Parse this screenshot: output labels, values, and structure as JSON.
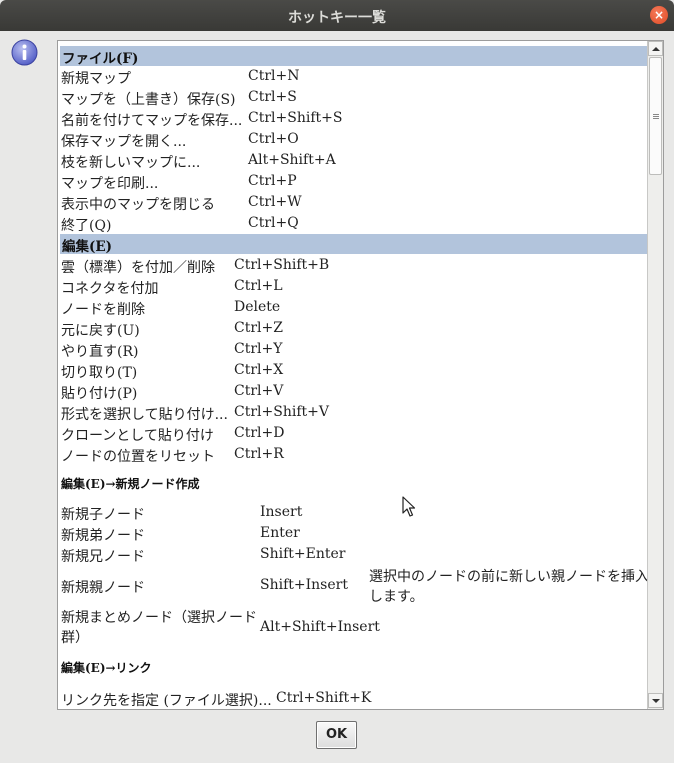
{
  "window": {
    "title": "ホットキー一覧",
    "close_label": "×"
  },
  "sections": [
    {
      "title": "ファイル(F)",
      "rows": [
        [
          "新規マップ",
          "Ctrl+N"
        ],
        [
          "マップを（上書き）保存(S)",
          "Ctrl+S"
        ],
        [
          "名前を付けてマップを保存...",
          "Ctrl+Shift+S"
        ],
        [
          "保存マップを開く...",
          "Ctrl+O"
        ],
        [
          "枝を新しいマップに...",
          "Alt+Shift+A"
        ],
        [
          "マップを印刷...",
          "Ctrl+P"
        ],
        [
          "表示中のマップを閉じる",
          "Ctrl+W"
        ],
        [
          "終了(Q)",
          "Ctrl+Q"
        ]
      ]
    },
    {
      "title": "編集(E)",
      "rows": [
        [
          "雲（標準）を付加／削除",
          "Ctrl+Shift+B"
        ],
        [
          "コネクタを付加",
          "Ctrl+L"
        ],
        [
          "ノードを削除",
          "Delete"
        ],
        [
          "元に戻す(U)",
          "Ctrl+Z"
        ],
        [
          "やり直す(R)",
          "Ctrl+Y"
        ],
        [
          "切り取り(T)",
          "Ctrl+X"
        ],
        [
          "貼り付け(P)",
          "Ctrl+V"
        ],
        [
          "形式を選択して貼り付け...",
          "Ctrl+Shift+V"
        ],
        [
          "クローンとして貼り付け",
          "Ctrl+D"
        ],
        [
          "ノードの位置をリセット",
          "Ctrl+R"
        ]
      ]
    }
  ],
  "subsections": [
    {
      "title": "編集(E)→新規ノード作成",
      "rows": [
        [
          "新規子ノード",
          "Insert",
          ""
        ],
        [
          "新規弟ノード",
          "Enter",
          ""
        ],
        [
          "新規兄ノード",
          "Shift+Enter",
          ""
        ],
        [
          "新規親ノード",
          "Shift+Insert",
          "選択中のノードの前に新しい親ノードを挿入します。"
        ],
        [
          "新規まとめノード（選択ノード群）",
          "Alt+Shift+Insert",
          ""
        ]
      ]
    },
    {
      "title": "編集(E)→リンク",
      "rows": [
        [
          "リンク先を指定 (ファイル選択)...",
          "Ctrl+Shift+K",
          ""
        ]
      ]
    }
  ],
  "buttons": {
    "ok": "OK"
  },
  "icons": {
    "info": "info-icon",
    "close": "close-icon",
    "scroll_up": "chevron-up-icon",
    "scroll_down": "chevron-down-icon",
    "cursor": "mouse-pointer-icon"
  }
}
